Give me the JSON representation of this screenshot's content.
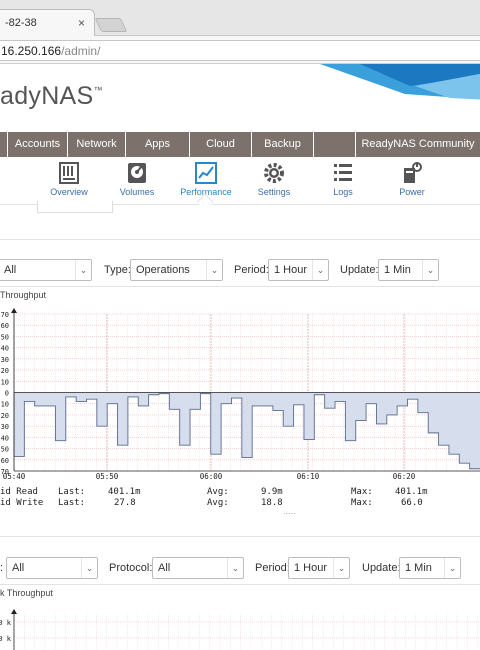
{
  "browser": {
    "tab_title": "-82-38",
    "tab_close": "×",
    "url_host": "16.250.166",
    "url_path": "/admin/"
  },
  "brand": {
    "name": "adyNAS",
    "tm": "™"
  },
  "main_nav": [
    {
      "label": "",
      "w": 0
    },
    {
      "label": "Accounts"
    },
    {
      "label": "Network"
    },
    {
      "label": "Apps"
    },
    {
      "label": "Cloud"
    },
    {
      "label": "Backup"
    },
    {
      "label": ""
    },
    {
      "label": "ReadyNAS Community"
    }
  ],
  "sub_nav": {
    "overview": "Overview",
    "volumes": "Volumes",
    "performance": "Performance",
    "settings": "Settings",
    "logs": "Logs",
    "power": "Power"
  },
  "filters1": {
    "first_value": "All",
    "type_label": "Type:",
    "type_value": "Operations",
    "period_label": "Period:",
    "period_value": "1 Hour",
    "update_label": "Update:",
    "update_value": "1 Min",
    "arrow": "⌄"
  },
  "panel1_title": "Throughput",
  "stats": {
    "read_label": "id Read",
    "write_label": "id Write",
    "last": "Last:",
    "avg": "Avg:",
    "max": "Max:",
    "read_last": "401.1m",
    "read_avg": "9.9m",
    "read_max": "401.1m",
    "write_last": "27.8",
    "write_avg": "18.8",
    "write_max": "66.0",
    "dots": "....."
  },
  "filters2": {
    "first_label": ":",
    "first_value": "All",
    "protocol_label": "Protocol:",
    "protocol_value": "All",
    "period_label": "Period:",
    "period_value": "1 Hour",
    "update_label": "Update:",
    "update_value": "1 Min",
    "arrow": "⌄"
  },
  "panel2_title": "k Throughput",
  "panel2_ticks": [
    "0 k",
    "0 k"
  ],
  "chart_data": {
    "type": "area",
    "y_ticks": [
      "70",
      "60",
      "50",
      "40",
      "30",
      "20",
      "10",
      "0",
      "10",
      "20",
      "30",
      "40",
      "50",
      "60",
      "70"
    ],
    "x_ticks": [
      "05:40",
      "05:50",
      "06:00",
      "06:10",
      "06:20"
    ],
    "ylim": [
      -70,
      70
    ],
    "series": [
      {
        "name": "id Write",
        "values": [
          -57,
          -8,
          -12,
          -12,
          -43,
          -4,
          -8,
          -6,
          -30,
          -10,
          -47,
          -4,
          -12,
          -2,
          -1,
          -15,
          -47,
          -15,
          -1,
          -55,
          -10,
          -5,
          -58,
          -12,
          -12,
          -16,
          -30,
          -11,
          -42,
          -2,
          -14,
          -8,
          -43,
          -25,
          -10,
          -28,
          -20,
          -12,
          -6,
          -18,
          -36,
          -47,
          -55,
          -63,
          -68
        ]
      }
    ],
    "grid": true,
    "legend": "none"
  }
}
